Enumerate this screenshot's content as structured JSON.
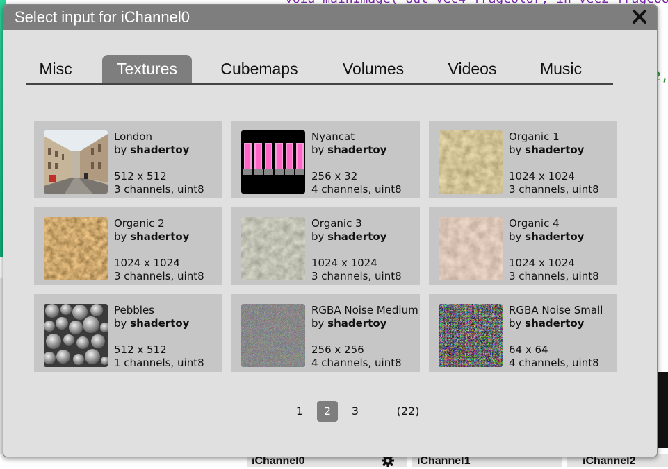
{
  "background": {
    "code_line": "void mainImage( out vec4 fragColor, in vec2 fragCoo",
    "code_fragment": "2,",
    "channels": [
      "iChannel0",
      "iChannel1",
      "iChannel2"
    ]
  },
  "dialog": {
    "title": "Select input for iChannel0",
    "close_icon": "close-icon"
  },
  "tabs": [
    {
      "label": "Misc",
      "active": false
    },
    {
      "label": "Textures",
      "active": true
    },
    {
      "label": "Cubemaps",
      "active": false
    },
    {
      "label": "Volumes",
      "active": false
    },
    {
      "label": "Videos",
      "active": false
    },
    {
      "label": "Music",
      "active": false
    }
  ],
  "textures": [
    {
      "name": "London",
      "by_prefix": "by ",
      "author": "shadertoy",
      "size": "512 x 512",
      "format": "3 channels, uint8"
    },
    {
      "name": "Nyancat",
      "by_prefix": "by ",
      "author": "shadertoy",
      "size": "256 x 32",
      "format": "4 channels, uint8"
    },
    {
      "name": "Organic 1",
      "by_prefix": "by ",
      "author": "shadertoy",
      "size": "1024 x 1024",
      "format": "3 channels, uint8"
    },
    {
      "name": "Organic 2",
      "by_prefix": "by ",
      "author": "shadertoy",
      "size": "1024 x 1024",
      "format": "3 channels, uint8"
    },
    {
      "name": "Organic 3",
      "by_prefix": "by ",
      "author": "shadertoy",
      "size": "1024 x 1024",
      "format": "3 channels, uint8"
    },
    {
      "name": "Organic 4",
      "by_prefix": "by ",
      "author": "shadertoy",
      "size": "1024 x 1024",
      "format": "3 channels, uint8"
    },
    {
      "name": "Pebbles",
      "by_prefix": "by ",
      "author": "shadertoy",
      "size": "512 x 512",
      "format": "1 channels, uint8"
    },
    {
      "name": "RGBA Noise Medium",
      "by_prefix": "by ",
      "author": "shadertoy",
      "size": "256 x 256",
      "format": "4 channels, uint8"
    },
    {
      "name": "RGBA Noise Small",
      "by_prefix": "by ",
      "author": "shadertoy",
      "size": "64 x 64",
      "format": "4 channels, uint8"
    }
  ],
  "pagination": {
    "pages": [
      "1",
      "2",
      "3"
    ],
    "current": "2",
    "total": "(22)"
  },
  "colors": {
    "titlebar": "#7e7e7e",
    "dialog_bg": "#e0e0e0",
    "card_bg": "#c6c6c6",
    "active_tab": "#7e7e7e"
  }
}
